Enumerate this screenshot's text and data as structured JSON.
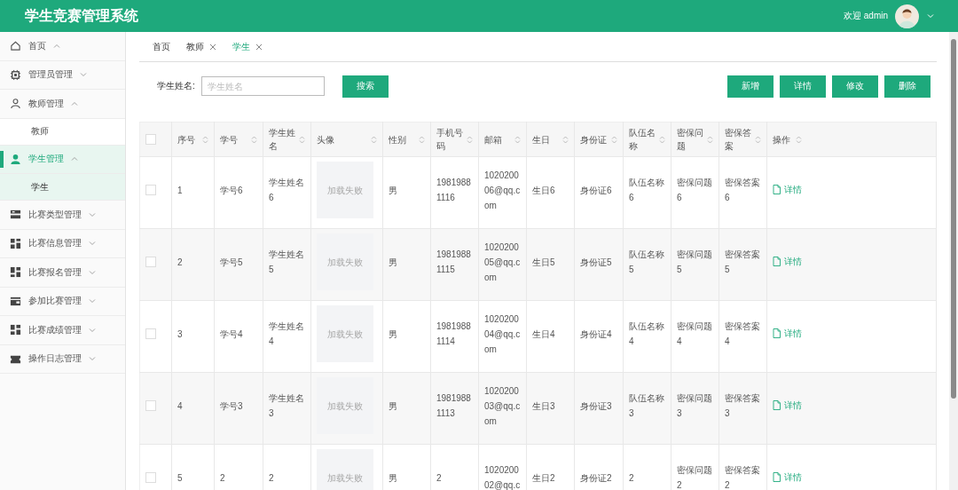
{
  "header": {
    "title": "学生竞赛管理系统",
    "welcome": "欢迎 admin"
  },
  "sidebar": {
    "items": [
      {
        "label": "首页",
        "expanded": true,
        "selected": false
      },
      {
        "label": "管理员管理",
        "expanded": false,
        "selected": false
      },
      {
        "label": "教师管理",
        "expanded": true,
        "selected": false,
        "children": [
          {
            "label": "教师",
            "selected": false
          }
        ]
      },
      {
        "label": "学生管理",
        "expanded": true,
        "selected": true,
        "children": [
          {
            "label": "学生",
            "selected": true
          }
        ]
      },
      {
        "label": "比赛类型管理",
        "expanded": false,
        "selected": false
      },
      {
        "label": "比赛信息管理",
        "expanded": false,
        "selected": false
      },
      {
        "label": "比赛报名管理",
        "expanded": false,
        "selected": false
      },
      {
        "label": "参加比赛管理",
        "expanded": false,
        "selected": false
      },
      {
        "label": "比赛成绩管理",
        "expanded": false,
        "selected": false
      },
      {
        "label": "操作日志管理",
        "expanded": false,
        "selected": false
      }
    ]
  },
  "tabs": [
    {
      "label": "首页",
      "closable": false,
      "selected": false
    },
    {
      "label": "教师",
      "closable": true,
      "selected": false
    },
    {
      "label": "学生",
      "closable": true,
      "selected": true
    }
  ],
  "search": {
    "label": "学生姓名:",
    "placeholder": "学生姓名",
    "button": "搜索"
  },
  "actions": [
    "新增",
    "详情",
    "修改",
    "删除"
  ],
  "table": {
    "select_all_checked": false,
    "columns": [
      {
        "label": "序号",
        "kind": "text"
      },
      {
        "label": "学号",
        "kind": "text"
      },
      {
        "label": "学生姓名",
        "kind": "text"
      },
      {
        "label": "头像",
        "kind": "image"
      },
      {
        "label": "性别",
        "kind": "text"
      },
      {
        "label": "手机号码",
        "kind": "text"
      },
      {
        "label": "邮箱",
        "kind": "text"
      },
      {
        "label": "生日",
        "kind": "text"
      },
      {
        "label": "身份证",
        "kind": "text"
      },
      {
        "label": "队伍名称",
        "kind": "text"
      },
      {
        "label": "密保问题",
        "kind": "text"
      },
      {
        "label": "密保答案",
        "kind": "text"
      },
      {
        "label": "操作",
        "kind": "action"
      }
    ],
    "rows": [
      {
        "checked": false,
        "cells": [
          "1",
          "学号6",
          "学生姓名6",
          "加载失败",
          "男",
          "19819881116",
          "102020006@qq.com",
          "生日6",
          "身份证6",
          "队伍名称6",
          "密保问题6",
          "密保答案6",
          "详情"
        ]
      },
      {
        "checked": false,
        "cells": [
          "2",
          "学号5",
          "学生姓名5",
          "加载失败",
          "男",
          "19819881115",
          "102020005@qq.com",
          "生日5",
          "身份证5",
          "队伍名称5",
          "密保问题5",
          "密保答案5",
          "详情"
        ]
      },
      {
        "checked": false,
        "cells": [
          "3",
          "学号4",
          "学生姓名4",
          "加载失败",
          "男",
          "19819881114",
          "102020004@qq.com",
          "生日4",
          "身份证4",
          "队伍名称4",
          "密保问题4",
          "密保答案4",
          "详情"
        ]
      },
      {
        "checked": false,
        "cells": [
          "4",
          "学号3",
          "学生姓名3",
          "加载失败",
          "男",
          "19819881113",
          "102020003@qq.com",
          "生日3",
          "身份证3",
          "队伍名称3",
          "密保问题3",
          "密保答案3",
          "详情"
        ]
      },
      {
        "checked": false,
        "cells": [
          "5",
          "2",
          "2",
          "加载失败",
          "男",
          "2",
          "102020002@qq.c",
          "生日2",
          "身份证2",
          "2",
          "密保问题2",
          "密保答案2",
          "详情"
        ]
      }
    ]
  }
}
